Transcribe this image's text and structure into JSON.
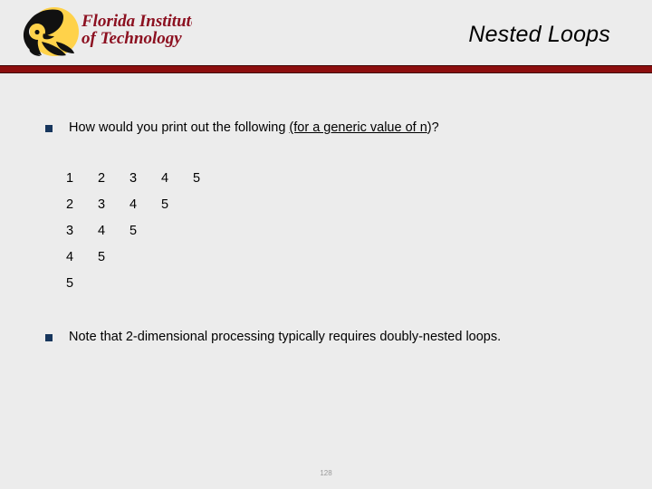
{
  "slide": {
    "title": "Nested Loops",
    "page_number": "128",
    "accent_rule_color": "#8c0e0e",
    "bullet_color": "#17365d",
    "background_color": "#ececec"
  },
  "logo": {
    "icon_name": "florida-tech-panther-logo",
    "line1": "Florida Institute",
    "line2": "of Technology",
    "text_color": "#8c1020",
    "disc_color": "#ffd24a",
    "panther_color": "#111111"
  },
  "bullets": [
    {
      "marker": "square-bullet-icon",
      "prefix": "How would you print out the following ",
      "underlined": "(for a generic value of n",
      "suffix": ")?"
    },
    {
      "marker": "square-bullet-icon",
      "text": "Note that 2-dimensional processing typically requires doubly-nested loops."
    }
  ],
  "number_grid": {
    "rows": [
      [
        "1",
        "2",
        "3",
        "4",
        "5"
      ],
      [
        "2",
        "3",
        "4",
        "5"
      ],
      [
        "3",
        "4",
        "5"
      ],
      [
        "4",
        "5"
      ],
      [
        "5"
      ]
    ]
  }
}
